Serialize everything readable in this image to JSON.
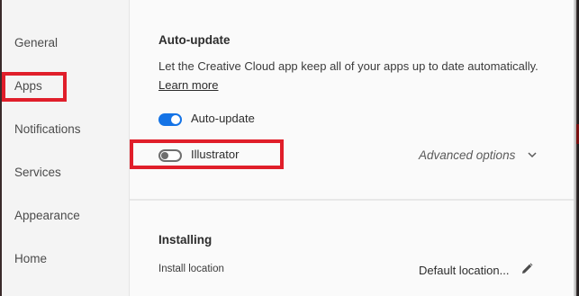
{
  "sidebar": {
    "items": [
      {
        "label": "General"
      },
      {
        "label": "Apps"
      },
      {
        "label": "Notifications"
      },
      {
        "label": "Services"
      },
      {
        "label": "Appearance"
      },
      {
        "label": "Home"
      }
    ]
  },
  "auto_update": {
    "heading": "Auto-update",
    "description": "Let the Creative Cloud app keep all of your apps up to date automatically.",
    "learn_more": "Learn more",
    "main_toggle": {
      "label": "Auto-update",
      "on": true
    },
    "app_toggle": {
      "label": "Illustrator",
      "on": false
    },
    "advanced_options": "Advanced options"
  },
  "installing": {
    "heading": "Installing",
    "install_location_label": "Install location",
    "install_location_value": "Default location..."
  },
  "icons": {
    "chevron": "chevron-down-icon",
    "edit": "pencil-icon"
  },
  "colors": {
    "accent": "#1473e6",
    "highlight": "#e01e2a"
  }
}
